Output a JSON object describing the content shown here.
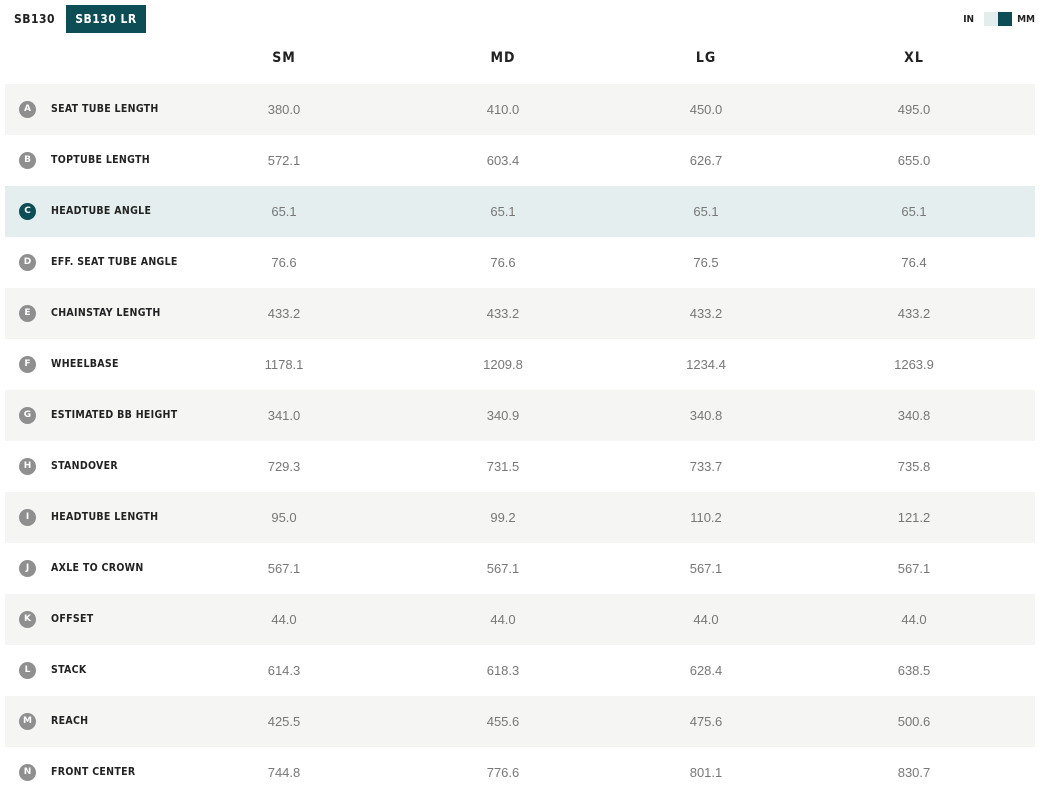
{
  "tabs": [
    {
      "label": "SB130",
      "active": false
    },
    {
      "label": "SB130 LR",
      "active": true
    }
  ],
  "units": {
    "left": "IN",
    "right": "MM",
    "selected": "MM"
  },
  "colors": {
    "accent": "#0d4d55",
    "row_alt": "#f5f5f3",
    "row_highlight": "#e4eeee"
  },
  "columns": [
    "SM",
    "MD",
    "LG",
    "XL"
  ],
  "rows": [
    {
      "letter": "A",
      "label": "SEAT TUBE LENGTH",
      "values": [
        "380.0",
        "410.0",
        "450.0",
        "495.0"
      ]
    },
    {
      "letter": "B",
      "label": "TOPTUBE LENGTH",
      "values": [
        "572.1",
        "603.4",
        "626.7",
        "655.0"
      ]
    },
    {
      "letter": "C",
      "label": "HEADTUBE ANGLE",
      "values": [
        "65.1",
        "65.1",
        "65.1",
        "65.1"
      ],
      "highlighted": true
    },
    {
      "letter": "D",
      "label": "EFF. SEAT TUBE ANGLE",
      "values": [
        "76.6",
        "76.6",
        "76.5",
        "76.4"
      ]
    },
    {
      "letter": "E",
      "label": "CHAINSTAY LENGTH",
      "values": [
        "433.2",
        "433.2",
        "433.2",
        "433.2"
      ]
    },
    {
      "letter": "F",
      "label": "WHEELBASE",
      "values": [
        "1178.1",
        "1209.8",
        "1234.4",
        "1263.9"
      ]
    },
    {
      "letter": "G",
      "label": "ESTIMATED BB HEIGHT",
      "values": [
        "341.0",
        "340.9",
        "340.8",
        "340.8"
      ]
    },
    {
      "letter": "H",
      "label": "STANDOVER",
      "values": [
        "729.3",
        "731.5",
        "733.7",
        "735.8"
      ]
    },
    {
      "letter": "I",
      "label": "HEADTUBE LENGTH",
      "values": [
        "95.0",
        "99.2",
        "110.2",
        "121.2"
      ]
    },
    {
      "letter": "J",
      "label": "AXLE TO CROWN",
      "values": [
        "567.1",
        "567.1",
        "567.1",
        "567.1"
      ]
    },
    {
      "letter": "K",
      "label": "OFFSET",
      "values": [
        "44.0",
        "44.0",
        "44.0",
        "44.0"
      ]
    },
    {
      "letter": "L",
      "label": "STACK",
      "values": [
        "614.3",
        "618.3",
        "628.4",
        "638.5"
      ]
    },
    {
      "letter": "M",
      "label": "REACH",
      "values": [
        "425.5",
        "455.6",
        "475.6",
        "500.6"
      ]
    },
    {
      "letter": "N",
      "label": "FRONT CENTER",
      "values": [
        "744.8",
        "776.6",
        "801.1",
        "830.7"
      ]
    }
  ]
}
